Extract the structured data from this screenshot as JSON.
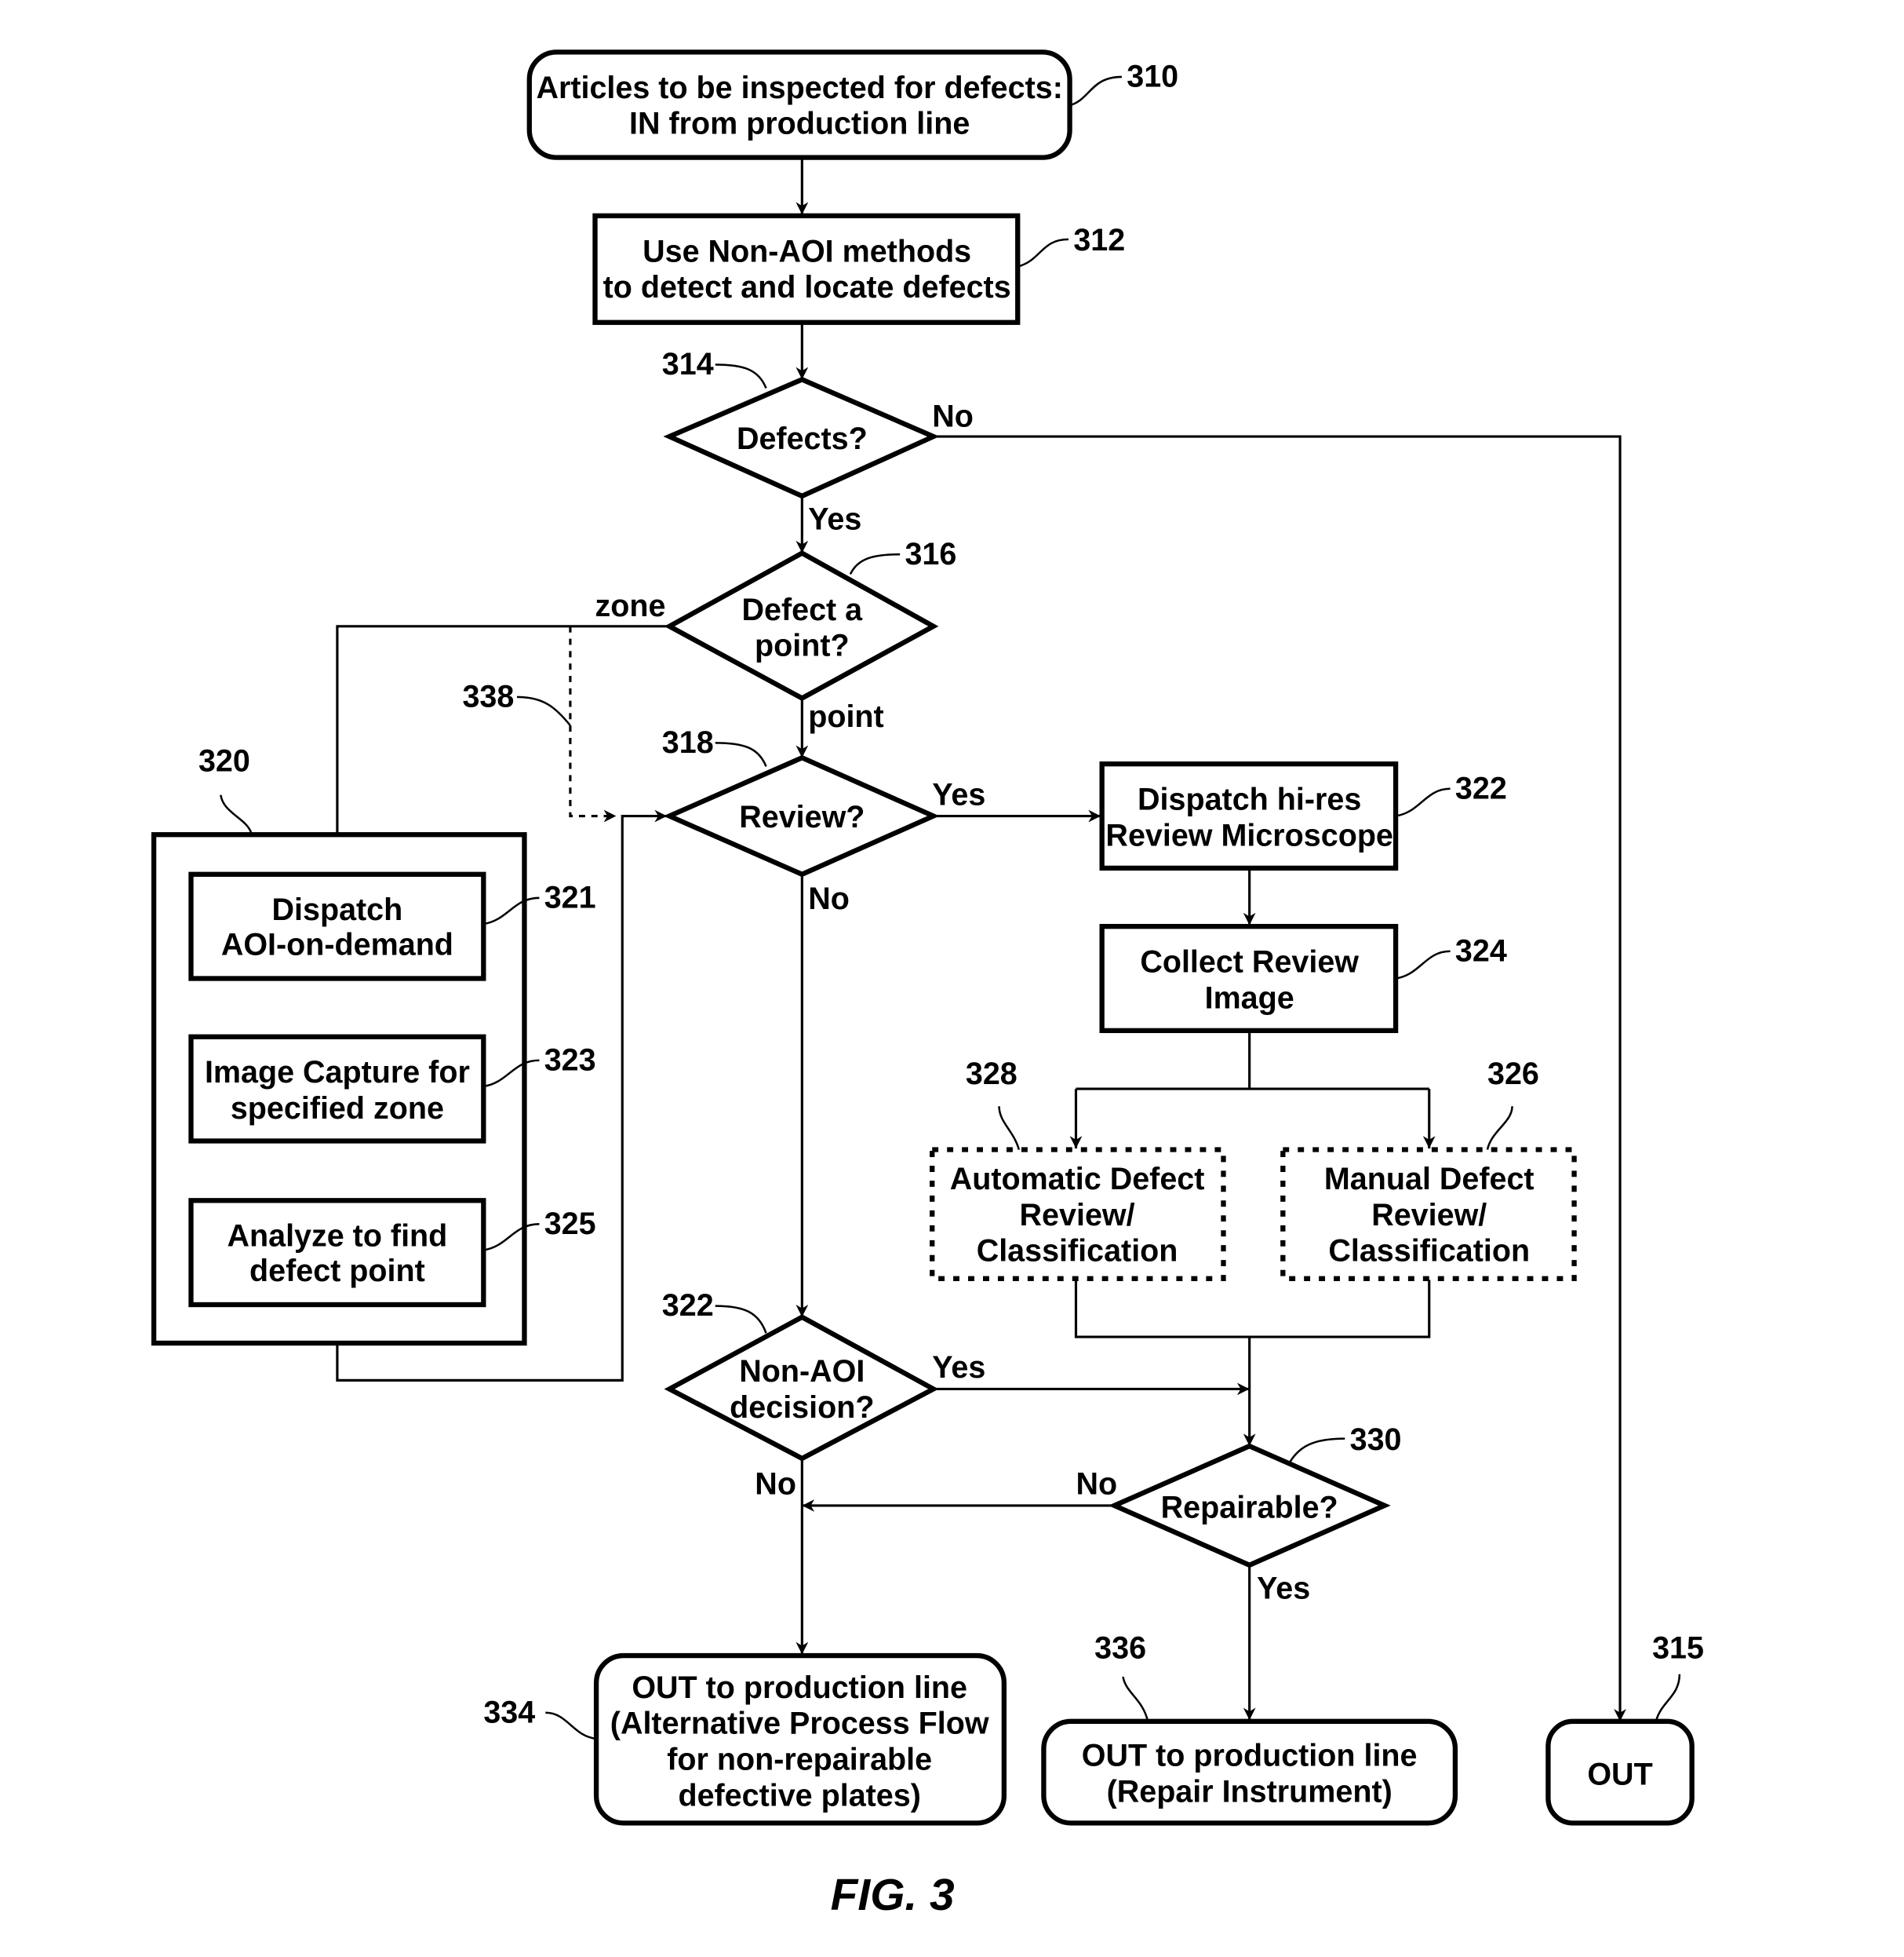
{
  "figure": {
    "caption": "FIG. 3"
  },
  "nodes": {
    "n310": {
      "ref": "310",
      "lines": [
        "Articles to be inspected for defects:",
        "IN from production line"
      ]
    },
    "n312": {
      "ref": "312",
      "lines": [
        "Use Non-AOI methods",
        "to detect and locate defects"
      ]
    },
    "n314": {
      "ref": "314",
      "lines": [
        "Defects?"
      ]
    },
    "n316": {
      "ref": "316",
      "lines": [
        "Defect a",
        "point?"
      ]
    },
    "n318": {
      "ref": "318",
      "lines": [
        "Review?"
      ]
    },
    "n320": {
      "ref": "320"
    },
    "n321": {
      "ref": "321",
      "lines": [
        "Dispatch",
        "AOI-on-demand"
      ]
    },
    "n323": {
      "ref": "323",
      "lines": [
        "Image Capture for",
        "specified zone"
      ]
    },
    "n325": {
      "ref": "325",
      "lines": [
        "Analyze to find",
        "defect point"
      ]
    },
    "n322a": {
      "ref": "322",
      "lines": [
        "Dispatch hi-res",
        "Review Microscope"
      ]
    },
    "n324": {
      "ref": "324",
      "lines": [
        "Collect Review",
        "Image"
      ]
    },
    "n328": {
      "ref": "328",
      "lines": [
        "Automatic Defect",
        "Review/",
        "Classification"
      ]
    },
    "n326": {
      "ref": "326",
      "lines": [
        "Manual Defect",
        "Review/",
        "Classification"
      ]
    },
    "n322b": {
      "ref": "322",
      "lines": [
        "Non-AOI",
        "decision?"
      ]
    },
    "n330": {
      "ref": "330",
      "lines": [
        "Repairable?"
      ]
    },
    "n334": {
      "ref": "334",
      "lines": [
        "OUT to production line",
        "(Alternative Process Flow",
        "for non-repairable",
        "defective plates)"
      ]
    },
    "n336": {
      "ref": "336",
      "lines": [
        "OUT to production line",
        "(Repair Instrument)"
      ]
    },
    "n315": {
      "ref": "315",
      "lines": [
        "OUT"
      ]
    },
    "n338": {
      "ref": "338"
    }
  },
  "edge_labels": {
    "defects_no": "No",
    "defects_yes": "Yes",
    "zone": "zone",
    "point": "point",
    "review_yes": "Yes",
    "review_no": "No",
    "nonaoi_yes": "Yes",
    "nonaoi_no": "No",
    "repairable_no": "No",
    "repairable_yes": "Yes"
  }
}
